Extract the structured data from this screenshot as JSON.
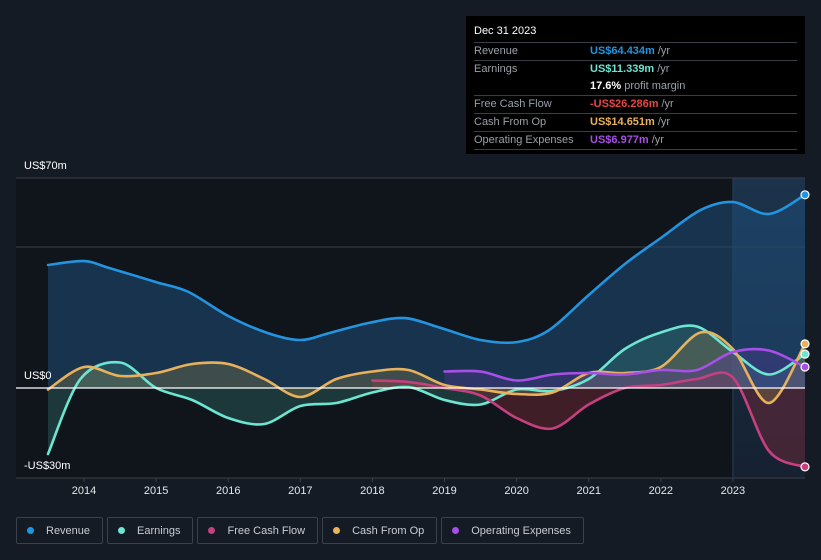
{
  "tooltip": {
    "date": "Dec 31 2023",
    "rows": [
      {
        "label": "Revenue",
        "value": "US$64.434m",
        "unit": "/yr",
        "color": "#2394df"
      },
      {
        "label": "Earnings",
        "value": "US$11.339m",
        "unit": "/yr",
        "color": "#6ce5d1"
      },
      {
        "label": "",
        "value": "17.6%",
        "unit": "profit margin",
        "color": "#ffffff"
      },
      {
        "label": "Free Cash Flow",
        "value": "-US$26.286m",
        "unit": "/yr",
        "color": "#e64545"
      },
      {
        "label": "Cash From Op",
        "value": "US$14.651m",
        "unit": "/yr",
        "color": "#e8b15b"
      },
      {
        "label": "Operating Expenses",
        "value": "US$6.977m",
        "unit": "/yr",
        "color": "#a94ee8"
      }
    ]
  },
  "legend": [
    {
      "label": "Revenue",
      "color": "#2394df"
    },
    {
      "label": "Earnings",
      "color": "#6ce5d1"
    },
    {
      "label": "Free Cash Flow",
      "color": "#c6407f"
    },
    {
      "label": "Cash From Op",
      "color": "#e8b15b"
    },
    {
      "label": "Operating Expenses",
      "color": "#a94ee8"
    }
  ],
  "chart_data": {
    "type": "area",
    "title": "",
    "xlabel": "",
    "ylabel": "",
    "y_tick_labels": [
      {
        "value": 70,
        "label": "US$70m"
      },
      {
        "value": 0,
        "label": "US$0"
      },
      {
        "value": -30,
        "label": "-US$30m"
      }
    ],
    "x_tick_labels": [
      "2014",
      "2015",
      "2016",
      "2017",
      "2018",
      "2019",
      "2020",
      "2021",
      "2022",
      "2023"
    ],
    "x_ticks": [
      2014,
      2015,
      2016,
      2017,
      2018,
      2019,
      2020,
      2021,
      2022,
      2023
    ],
    "xlim": [
      2013.5,
      2024.0
    ],
    "ylim": [
      -30,
      70
    ],
    "gridlines": [
      70,
      47,
      0
    ],
    "highlight_region": [
      2023.0,
      2024.0
    ],
    "units": "US$ millions",
    "series": [
      {
        "name": "Revenue",
        "color": "#2394df",
        "x": [
          2013.5,
          2014.0,
          2014.35,
          2015.0,
          2015.45,
          2016.0,
          2016.55,
          2017.0,
          2017.4,
          2017.95,
          2018.45,
          2018.95,
          2019.5,
          2020.0,
          2020.45,
          2021.0,
          2021.5,
          2022.0,
          2022.55,
          2023.0,
          2023.5,
          2024.0
        ],
        "values": [
          41,
          42.3,
          40,
          35.3,
          32,
          24,
          18.3,
          16,
          18.3,
          21.7,
          23.3,
          20,
          16,
          15.3,
          19.3,
          31,
          41.3,
          50,
          59.3,
          62,
          58,
          64.4
        ]
      },
      {
        "name": "Earnings",
        "color": "#6ce5d1",
        "x": [
          2013.5,
          2013.95,
          2014.5,
          2015.0,
          2015.5,
          2016.0,
          2016.5,
          2017.0,
          2017.5,
          2018.0,
          2018.5,
          2019.0,
          2019.5,
          2020.0,
          2020.5,
          2021.0,
          2021.5,
          2022.0,
          2022.5,
          2023.0,
          2023.5,
          2024.0
        ],
        "values": [
          -22,
          3,
          8.5,
          0,
          -4,
          -10,
          -12,
          -6,
          -5,
          -1.5,
          0.3,
          -4,
          -5.5,
          -0.5,
          -1,
          3,
          13,
          18.5,
          20.5,
          12,
          4.5,
          11.3
        ]
      },
      {
        "name": "Free Cash Flow",
        "color": "#c6407f",
        "x": [
          2018.0,
          2018.5,
          2019.0,
          2019.5,
          2020.0,
          2020.5,
          2021.0,
          2021.5,
          2022.0,
          2022.5,
          2023.0,
          2023.5,
          2024.0
        ],
        "values": [
          2.5,
          2.0,
          0,
          -2.5,
          -10,
          -13.5,
          -5.5,
          0,
          1,
          3,
          3.5,
          -21,
          -26.3
        ]
      },
      {
        "name": "Cash From Op",
        "color": "#e8b15b",
        "x": [
          2013.5,
          2014.0,
          2014.5,
          2015.0,
          2015.5,
          2016.0,
          2016.5,
          2017.0,
          2017.5,
          2018.0,
          2018.5,
          2019.0,
          2019.5,
          2020.0,
          2020.5,
          2021.0,
          2021.5,
          2022.0,
          2022.55,
          2023.0,
          2023.5,
          2024.0
        ],
        "values": [
          -0.5,
          7,
          4,
          5,
          8,
          8,
          3,
          -3,
          3,
          5.5,
          6,
          1,
          -0.5,
          -2,
          -1.5,
          5,
          5,
          7,
          18.5,
          13,
          -5,
          14.7
        ]
      },
      {
        "name": "Operating Expenses",
        "color": "#a94ee8",
        "x": [
          2019.0,
          2019.5,
          2020.0,
          2020.5,
          2021.0,
          2021.5,
          2022.0,
          2022.5,
          2023.0,
          2023.5,
          2024.0
        ],
        "values": [
          5.5,
          5.5,
          2.5,
          4.5,
          5,
          4.5,
          6,
          6,
          12,
          12.5,
          7
        ]
      }
    ]
  }
}
